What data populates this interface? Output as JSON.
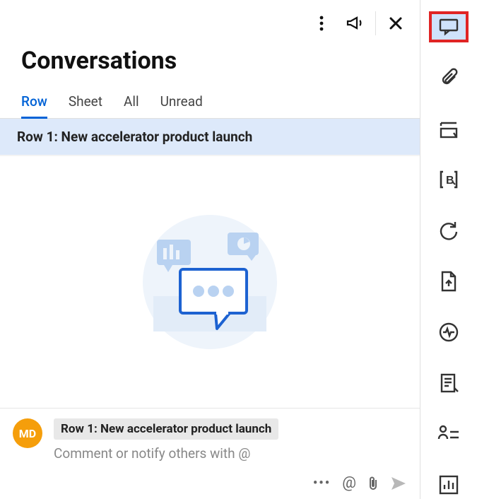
{
  "title": "Conversations",
  "tabs": [
    "Row",
    "Sheet",
    "All",
    "Unread"
  ],
  "active_tab": 0,
  "selected_row": "Row 1: New accelerator product launch",
  "avatar_initials": "MD",
  "composer_chip": "Row 1: New accelerator product launch",
  "composer_placeholder": "Comment or notify others with @",
  "colors": {
    "accent": "#0062d6",
    "avatar_bg": "#f59e0b",
    "highlight_bg": "#cfe2fb",
    "highlight_border": "#e02424",
    "row_selected_bg": "#dde9fa"
  },
  "rail_items": [
    {
      "name": "comments-icon",
      "highlight": true
    },
    {
      "name": "attachments-icon"
    },
    {
      "name": "format-icon"
    },
    {
      "name": "brackets-b-icon"
    },
    {
      "name": "refresh-icon"
    },
    {
      "name": "upload-file-icon"
    },
    {
      "name": "activity-icon"
    },
    {
      "name": "sheet-summary-icon"
    },
    {
      "name": "people-icon"
    },
    {
      "name": "chart-icon"
    }
  ]
}
